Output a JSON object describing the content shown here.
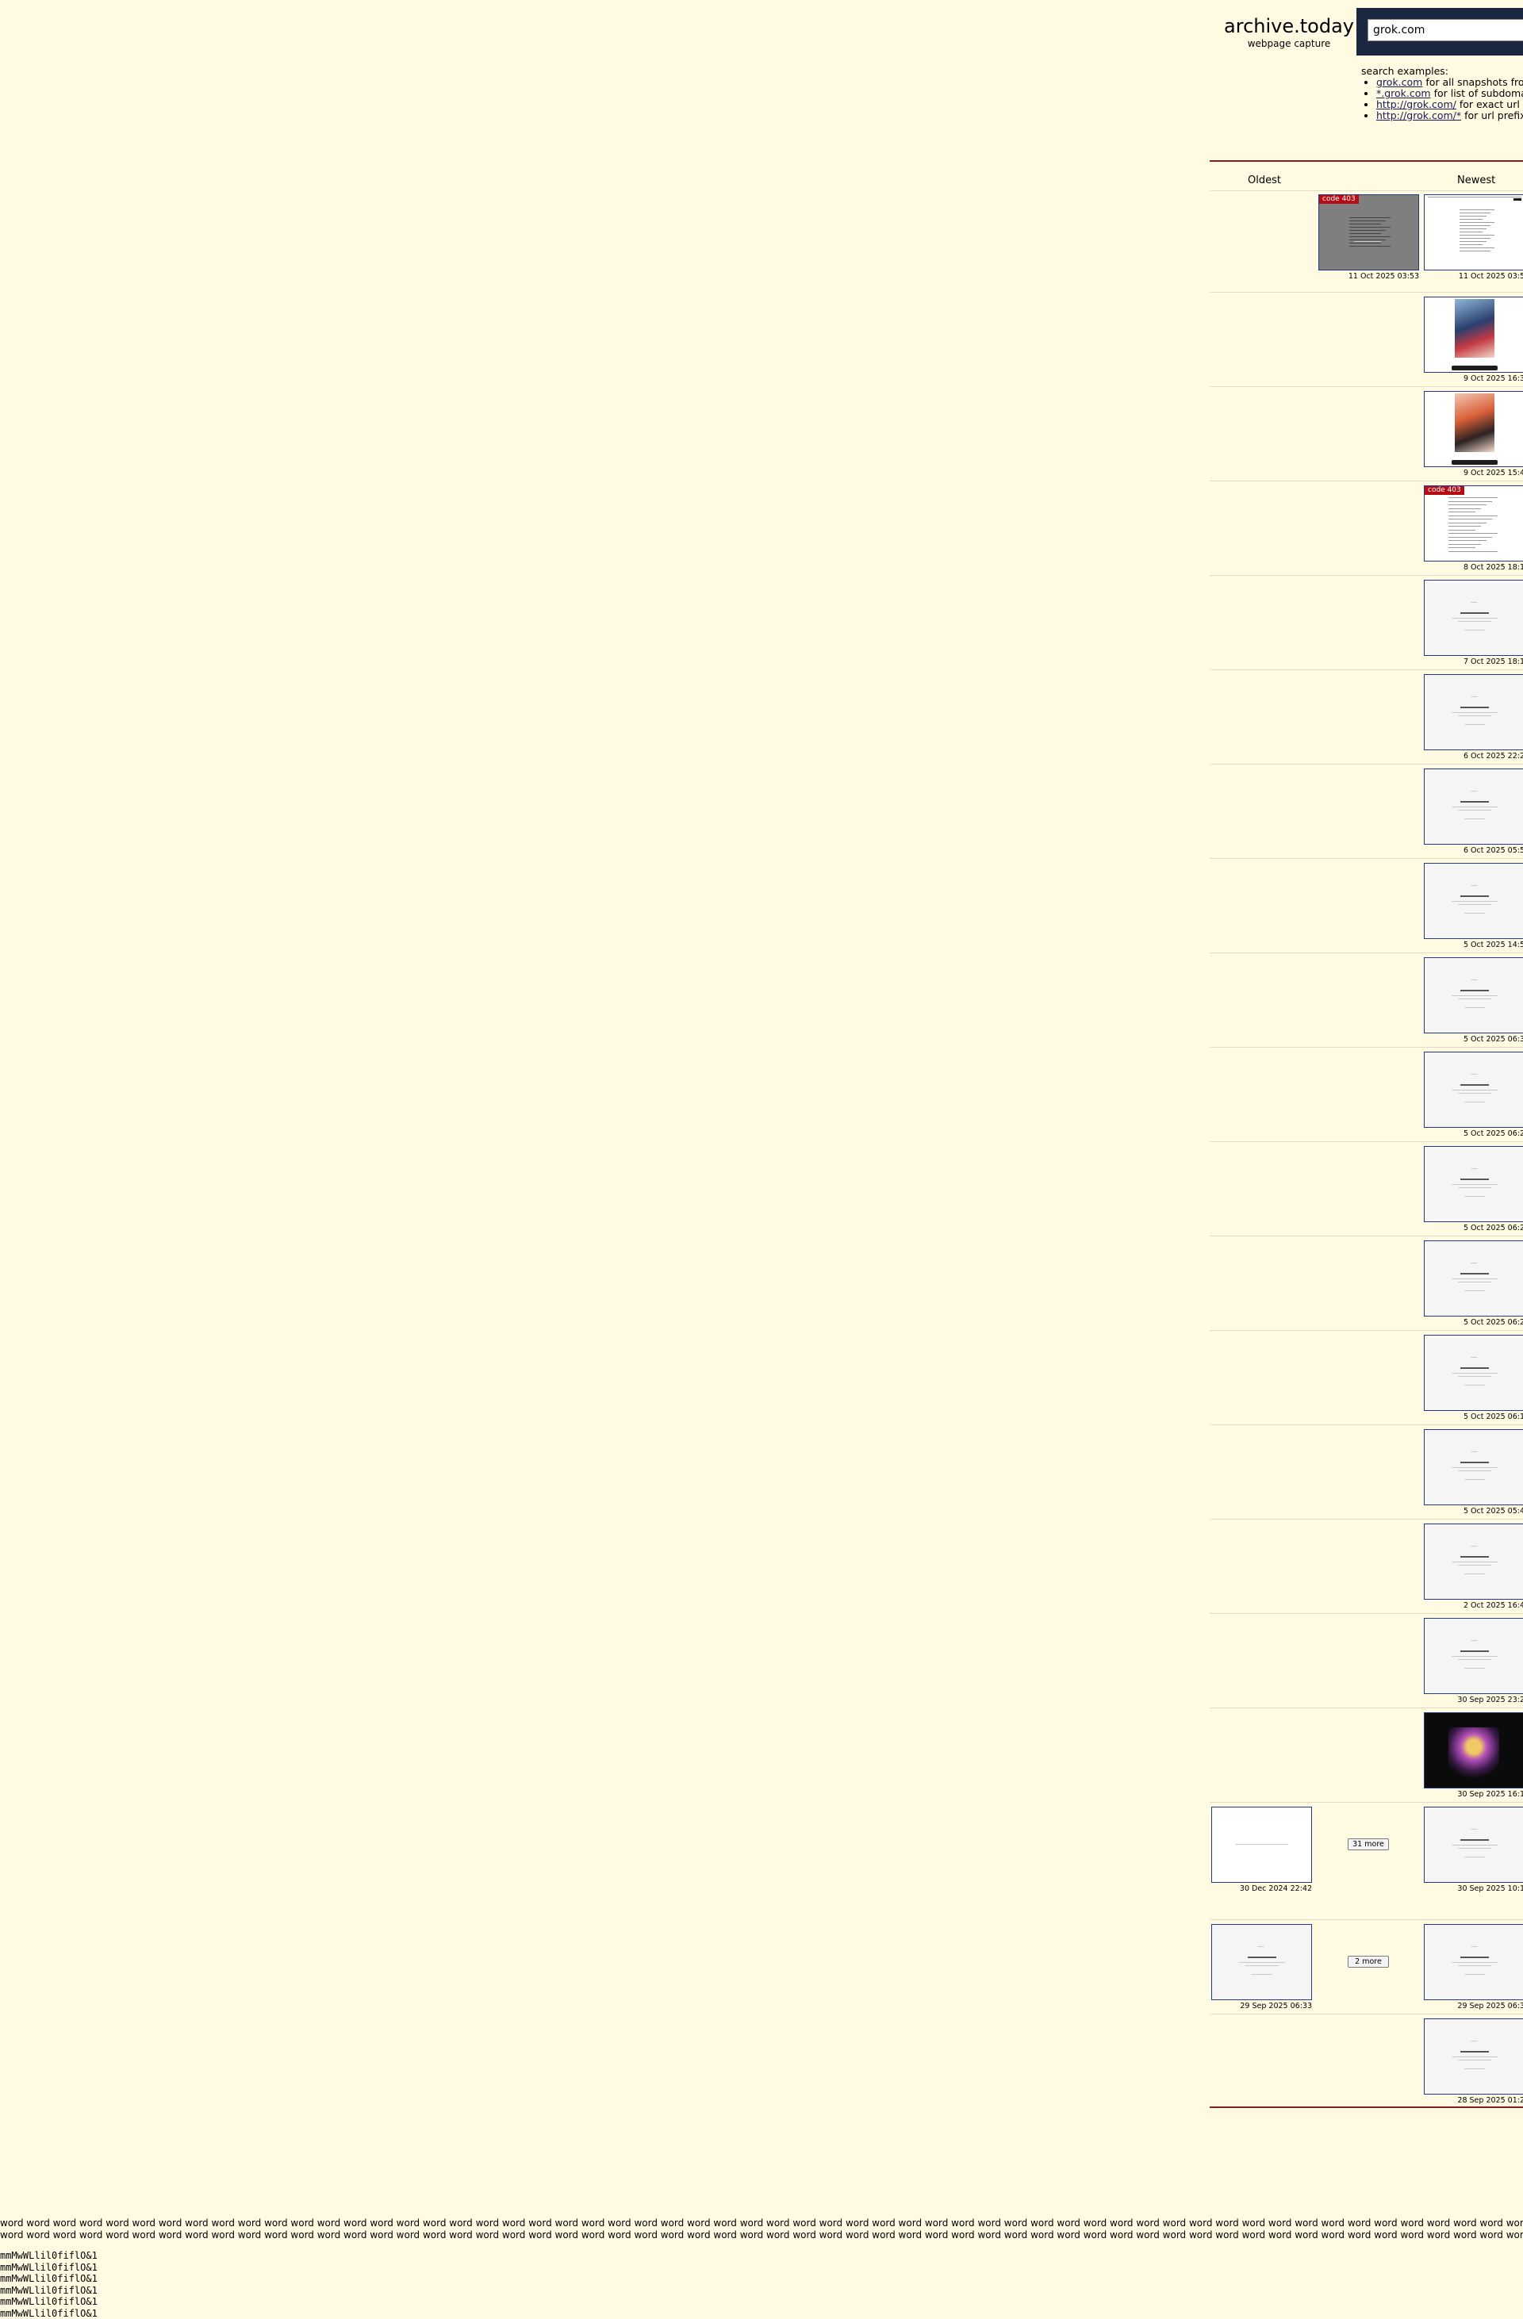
{
  "header": {
    "logo": "archive.today",
    "subtitle": "webpage capture",
    "search_value": "grok.com"
  },
  "examples": {
    "title": "search examples:",
    "items": [
      {
        "link": "grok.com",
        "text": " for all snapshots from th"
      },
      {
        "link": "*.grok.com",
        "text": " for list of subdomains"
      },
      {
        "link": "http://grok.com/",
        "text": " for exact url"
      },
      {
        "link": "http://grok.com/*",
        "text": " for url prefix"
      }
    ]
  },
  "columns": {
    "oldest": "Oldest",
    "newest": "Newest"
  },
  "rows": [
    {
      "middle": {
        "date": "11 Oct 2025 03:53",
        "badge": "code 403",
        "style": "shade"
      },
      "newest": {
        "date": "11 Oct 2025 03:5",
        "style": "page"
      }
    },
    {
      "newest": {
        "date": "9 Oct 2025 16:3",
        "style": "photo-blue"
      }
    },
    {
      "newest": {
        "date": "9 Oct 2025 15:4",
        "style": "photo-pink"
      }
    },
    {
      "newest": {
        "date": "8 Oct 2025 18:1",
        "badge": "code 403",
        "style": "doc"
      }
    },
    {
      "newest": {
        "date": "7 Oct 2025 18:1",
        "style": "grey"
      }
    },
    {
      "newest": {
        "date": "6 Oct 2025 22:2",
        "style": "grey"
      }
    },
    {
      "newest": {
        "date": "6 Oct 2025 05:5",
        "style": "grey"
      }
    },
    {
      "newest": {
        "date": "5 Oct 2025 14:5",
        "style": "grey"
      }
    },
    {
      "newest": {
        "date": "5 Oct 2025 06:3",
        "style": "grey"
      }
    },
    {
      "newest": {
        "date": "5 Oct 2025 06:2",
        "style": "grey"
      }
    },
    {
      "newest": {
        "date": "5 Oct 2025 06:2",
        "style": "grey"
      }
    },
    {
      "newest": {
        "date": "5 Oct 2025 06:2",
        "style": "grey"
      }
    },
    {
      "newest": {
        "date": "5 Oct 2025 06:1",
        "style": "grey"
      }
    },
    {
      "newest": {
        "date": "5 Oct 2025 05:4",
        "style": "grey"
      }
    },
    {
      "newest": {
        "date": "2 Oct 2025 16:4",
        "style": "grey"
      }
    },
    {
      "newest": {
        "date": "30 Sep 2025 23:2",
        "style": "grey"
      }
    },
    {
      "newest": {
        "date": "30 Sep 2025 16:1",
        "style": "photo-dark"
      }
    },
    {
      "oldest": {
        "date": "30 Dec 2024 22:42",
        "style": "blank"
      },
      "more": "31 more",
      "newest": {
        "date": "30 Sep 2025 10:1",
        "style": "grey"
      }
    },
    {
      "oldest": {
        "date": "29 Sep 2025 06:33",
        "style": "grey"
      },
      "more": "2 more",
      "newest": {
        "date": "29 Sep 2025 06:3",
        "style": "grey"
      }
    },
    {
      "newest": {
        "date": "28 Sep 2025 01:2",
        "style": "grey"
      }
    }
  ],
  "footer": {
    "words": "word word word word word word word word word word word word word word word word word word word word word word word word word word word word word word word word word word word word word word word word word word word word word word word word word word word word word word word word word word word word word word word word word word word word word word word word word word word word word word word word word word word word word word word word word word word word word word word word word word word word word word word word word word word word word word word word word word word word word word word word word word word word word word word word word word word word word word word word word word word word word word word word word word word word word word word word word word word word word word word word word word word word word word word word word word word word",
    "glyph_lines": [
      "mmMwWLlil0fiflO&1",
      "mmMwWLlil0fiflO&1",
      "mmMwWLlil0fiflO&1",
      "mmMwWLlil0fiflO&1",
      "mmMwWLlil0fiflO&1",
      "mmMwWLlil0fiflO&1"
    ]
  },
  "colors": {
    "background": "#fffae2",
    "rule": "#7d1f27",
    "search_bg": "#1b2740",
    "thumb_border": "#233a8c",
    "badge": "#b60c14"
  }
}
